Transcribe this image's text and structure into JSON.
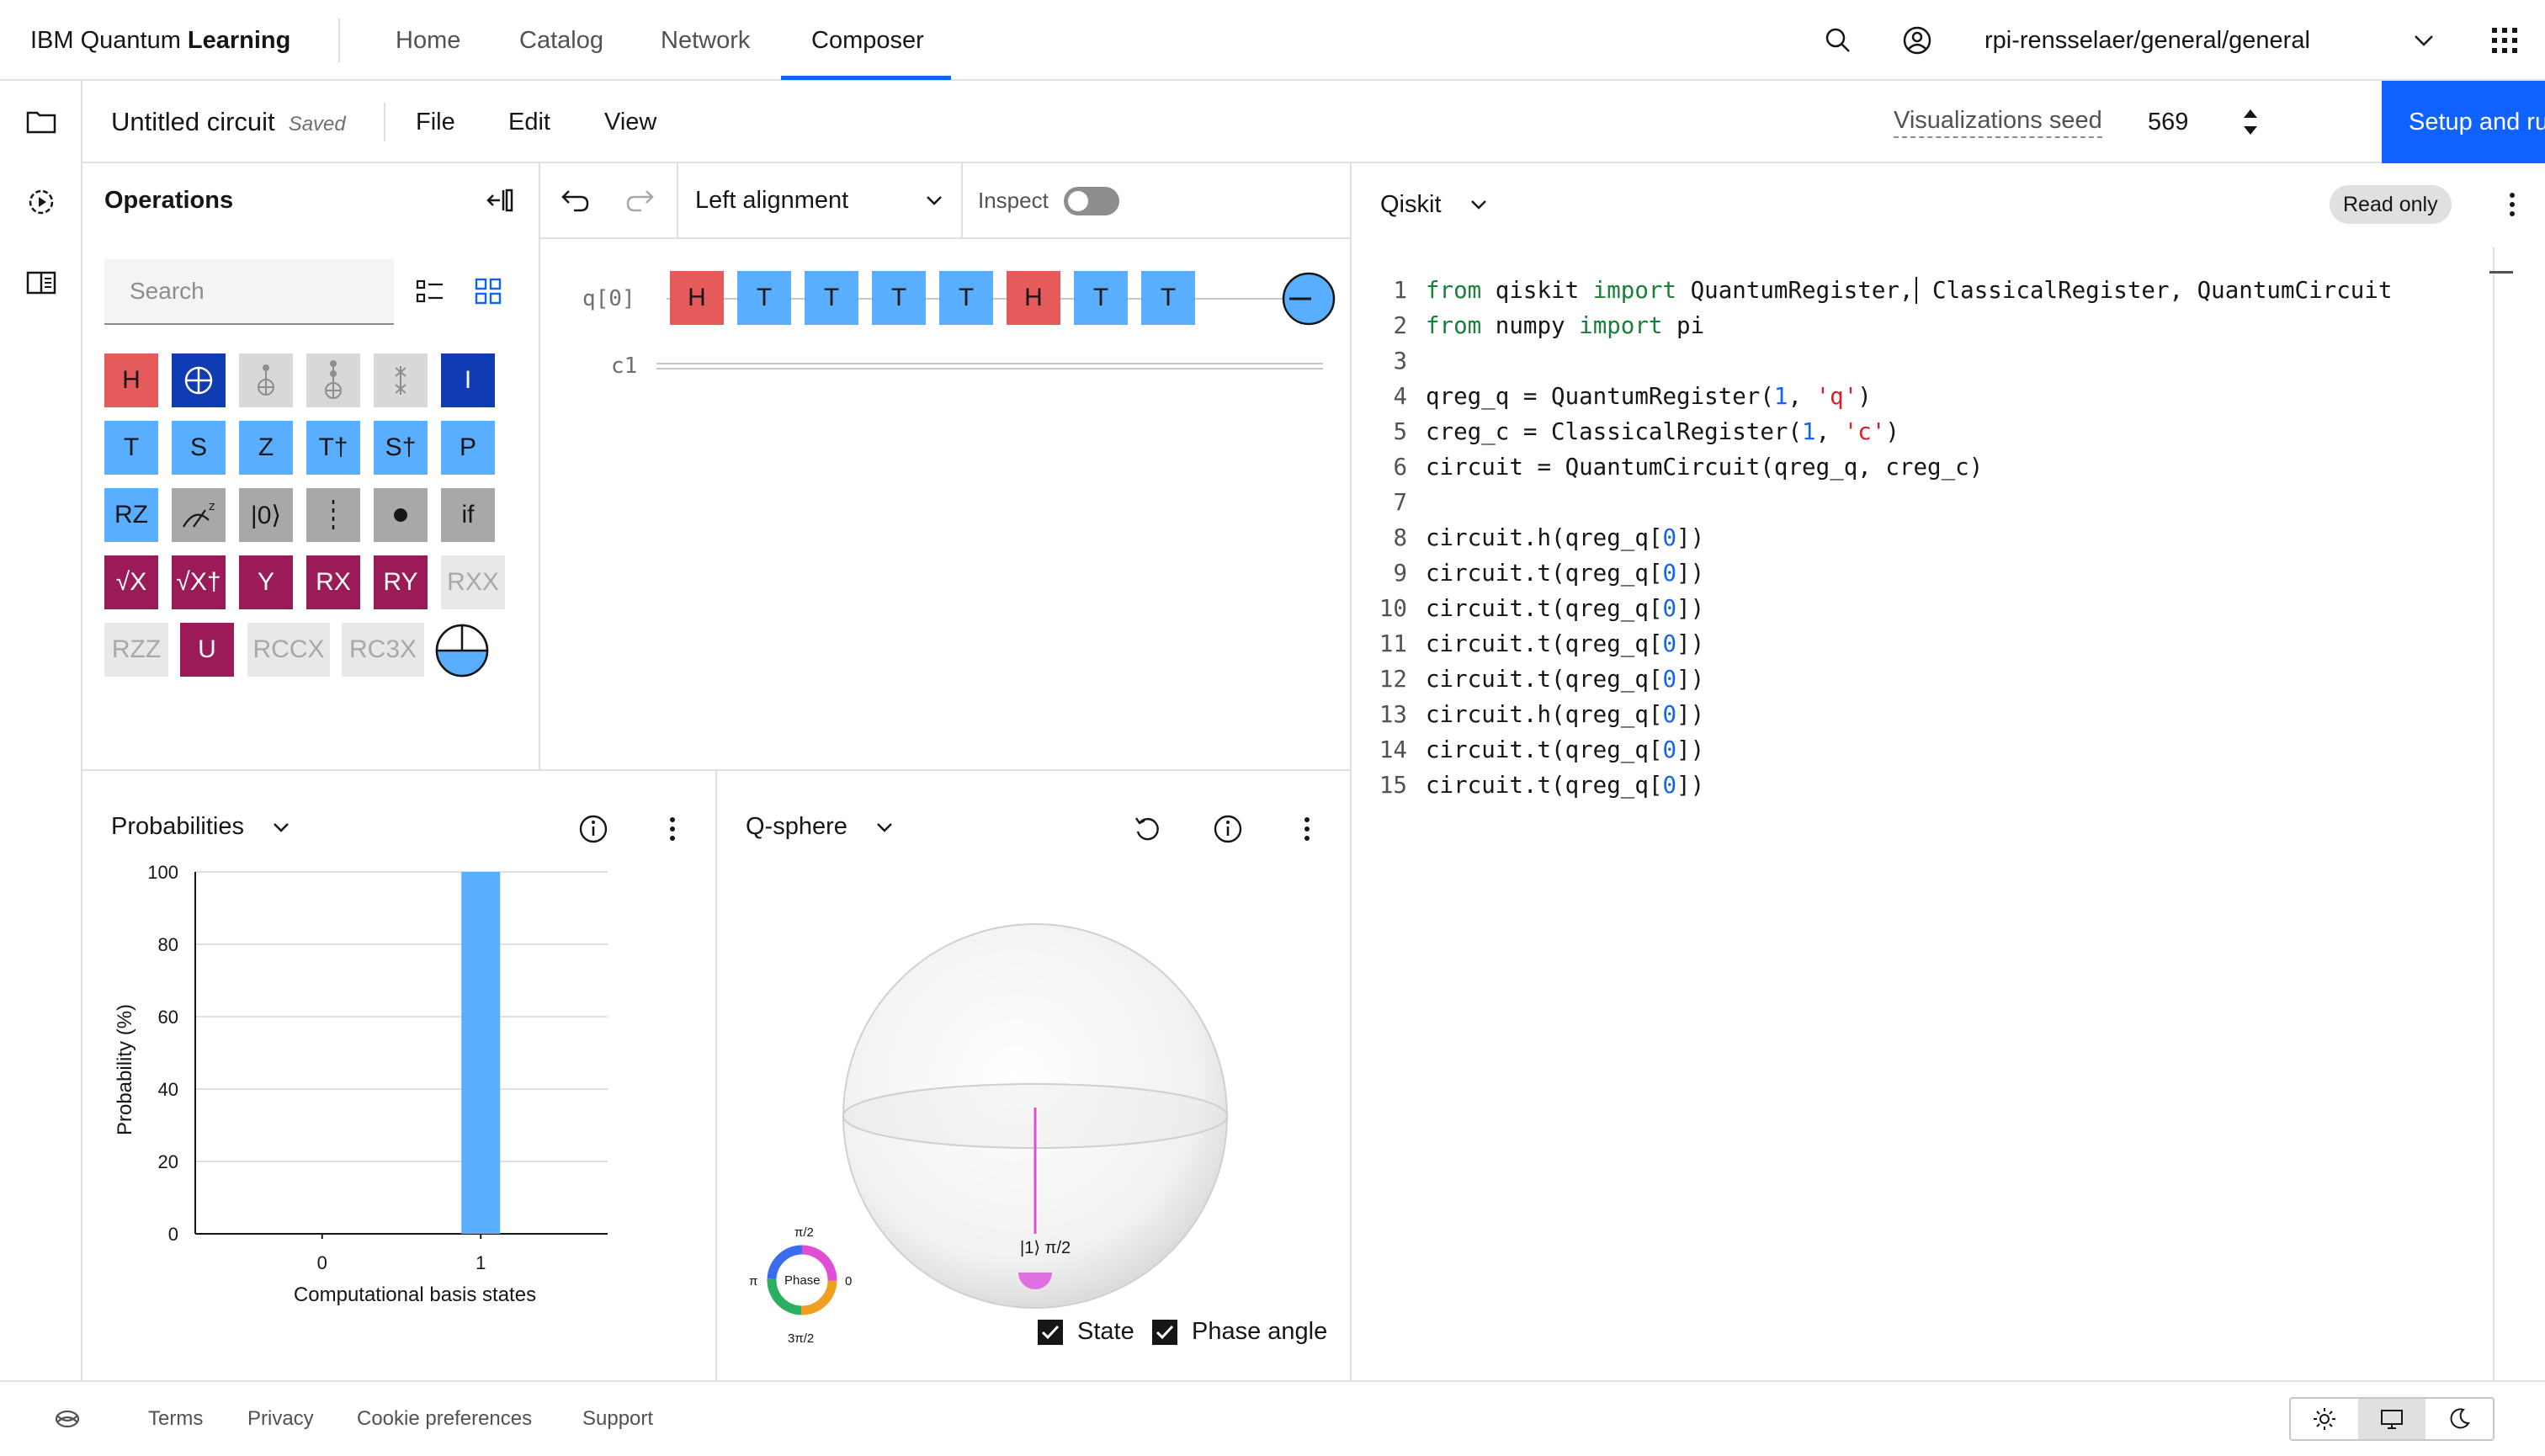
{
  "header": {
    "brand_prefix": "IBM Quantum",
    "brand_suffix": "Learning",
    "nav": [
      "Home",
      "Catalog",
      "Network",
      "Composer"
    ],
    "active_nav": "Composer",
    "account": "rpi-rensselaer/general/general"
  },
  "toolbar": {
    "circuit_title": "Untitled circuit",
    "saved_label": "Saved",
    "menus": [
      "File",
      "Edit",
      "View"
    ],
    "vis_seed_label": "Visualizations seed",
    "seed_value": "569",
    "setup_run_label": "Setup and run"
  },
  "operations": {
    "title": "Operations",
    "search_placeholder": "Search",
    "gates": {
      "h": "H",
      "i": "I",
      "t": "T",
      "s": "S",
      "z": "Z",
      "tdg": "T†",
      "sdg": "S†",
      "p": "P",
      "rz": "RZ",
      "reset": "|0⟩",
      "if": "if",
      "sx": "√X",
      "sxdg": "√X†",
      "y": "Y",
      "rx": "RX",
      "ry": "RY",
      "rxx": "RXX",
      "rzz": "RZZ",
      "u": "U",
      "rccx": "RCCX",
      "rc3x": "RC3X"
    }
  },
  "circuit": {
    "alignment": "Left alignment",
    "inspect_label": "Inspect",
    "qubit_label": "q[0]",
    "classical_label": "c1",
    "gates": [
      "H",
      "T",
      "T",
      "T",
      "T",
      "H",
      "T",
      "T"
    ]
  },
  "probabilities": {
    "title": "Probabilities",
    "chart_data": {
      "type": "bar",
      "categories": [
        "0",
        "1"
      ],
      "values": [
        0,
        100
      ],
      "xlabel": "Computational basis states",
      "ylabel": "Probability (%)",
      "ylim": [
        0,
        100
      ],
      "yticks": [
        "0",
        "20",
        "40",
        "60",
        "80",
        "100"
      ],
      "bar_color": "#5aaeff"
    }
  },
  "qsphere": {
    "title": "Q-sphere",
    "state_label": "|1⟩ π/2",
    "phase_wheel": {
      "center": "Phase",
      "top": "π/2",
      "right": "0",
      "bottom": "3π/2",
      "left": "π"
    },
    "checkbox_state": "State",
    "checkbox_phase": "Phase angle"
  },
  "code": {
    "language": "Qiskit",
    "readonly": "Read only",
    "lines": [
      "1",
      "2",
      "3",
      "4",
      "5",
      "6",
      "7",
      "8",
      "9",
      "10",
      "11",
      "12",
      "13",
      "14",
      "15"
    ]
  },
  "footer": {
    "links": [
      "Terms",
      "Privacy",
      "Cookie preferences",
      "Support"
    ]
  },
  "colors": {
    "accent": "#0f62fe",
    "gate_h": "#e55b5b",
    "gate_phase": "#5aaeff",
    "gate_rot": "#9a1b57"
  }
}
